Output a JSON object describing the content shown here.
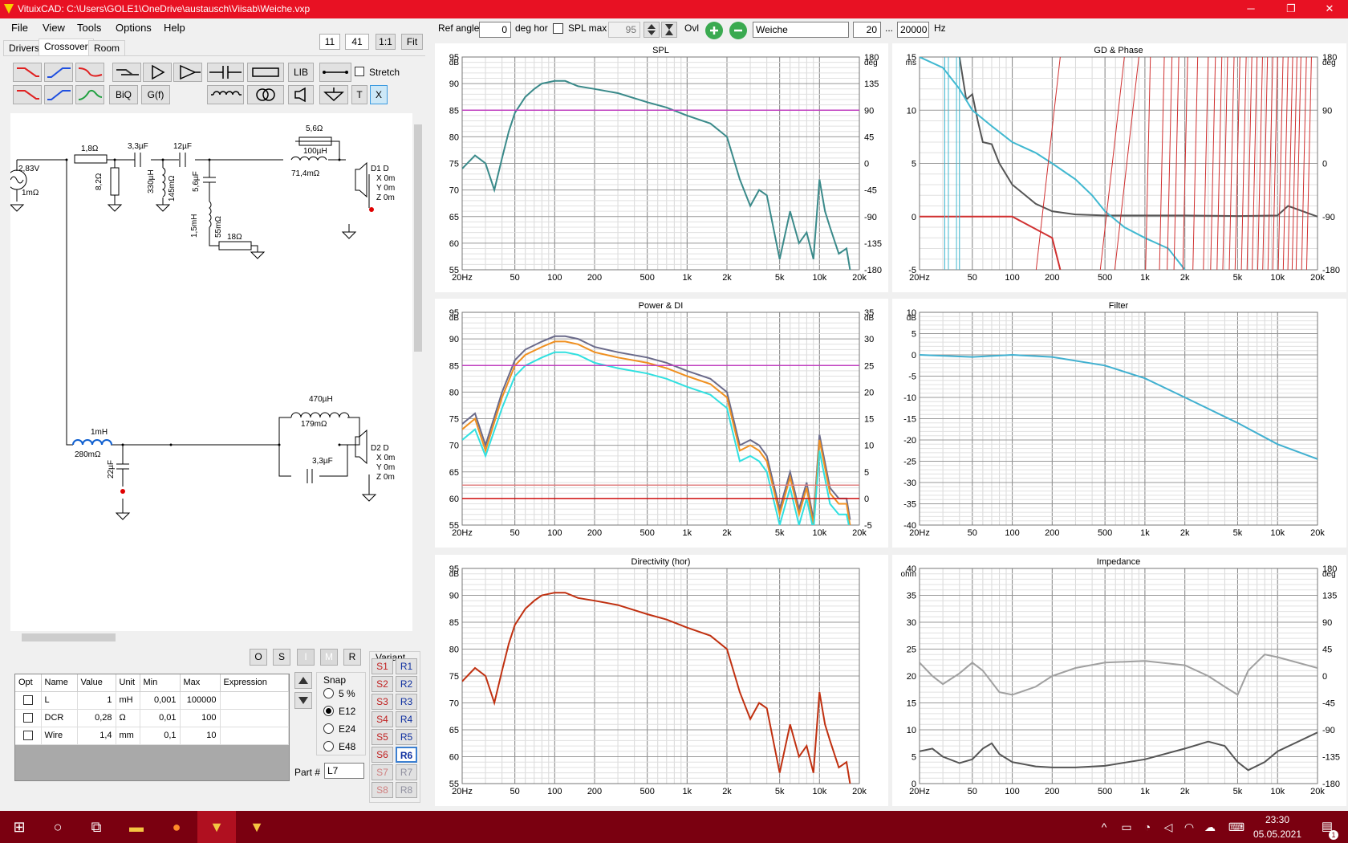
{
  "window": {
    "title": "VituixCAD: C:\\Users\\GOLE1\\OneDrive\\austausch\\Viisab\\Weiche.vxp",
    "min": "─",
    "max": "❐",
    "close": "✕"
  },
  "menu": [
    "File",
    "View",
    "Tools",
    "Options",
    "Help"
  ],
  "zoom": {
    "a": "11",
    "b": "41",
    "one": "1:1",
    "fit": "Fit"
  },
  "tabs": [
    "Drivers",
    "Crossover",
    "Room"
  ],
  "components_row1": [
    "BiQ",
    "G(f)"
  ],
  "lib_label": "LIB",
  "stretch_label": "Stretch",
  "t_label": "T",
  "x_label": "X",
  "schematic": {
    "source_v": "2,83V",
    "source_r": "1mΩ",
    "r1": "1,8Ω",
    "r2": "8,2Ω",
    "c1": "3,3µF",
    "l1": "330µH",
    "l1r": "145mΩ",
    "c2": "12µF",
    "c3": "5,6µF",
    "l2": "1,5mH",
    "l2r": "55mΩ",
    "r3": "18Ω",
    "r4": "5,6Ω",
    "l3": "100µH",
    "l3r": "71,4mΩ",
    "d1": "D1 D",
    "d1x": "X 0m",
    "d1y": "Y 0m",
    "d1z": "Z 0m",
    "l4": "1mH",
    "l4r": "280mΩ",
    "c4": "22µF",
    "l5": "470µH",
    "l5r": "179mΩ",
    "c5": "3,3µF",
    "d2": "D2 D",
    "d2x": "X 0m",
    "d2y": "Y 0m",
    "d2z": "Z 0m"
  },
  "osimr": [
    "O",
    "S",
    "I",
    "M",
    "R"
  ],
  "params": {
    "headers": [
      "Opt",
      "Name",
      "Value",
      "Unit",
      "Min",
      "Max",
      "Expression"
    ],
    "rows": [
      [
        "",
        "L",
        "1",
        "mH",
        "0,001",
        "100000",
        ""
      ],
      [
        "",
        "DCR",
        "0,28",
        "Ω",
        "0,01",
        "100",
        ""
      ],
      [
        "",
        "Wire",
        "1,4",
        "mm",
        "0,1",
        "10",
        ""
      ]
    ]
  },
  "snap": {
    "label": "Snap",
    "options": [
      "5 %",
      "E12",
      "E24",
      "E48"
    ],
    "selected": "E12"
  },
  "part": {
    "label": "Part #",
    "value": "L7"
  },
  "variant": {
    "label": "Variant",
    "s": [
      "S1",
      "S2",
      "S3",
      "S4",
      "S5",
      "S6",
      "S7",
      "S8"
    ],
    "r": [
      "R1",
      "R2",
      "R3",
      "R4",
      "R5",
      "R6",
      "R7",
      "R8"
    ],
    "active": "R6"
  },
  "controls": {
    "ref_angle_label": "Ref angle",
    "ref_angle": "0",
    "deg_hor": "deg hor",
    "spl_max_label": "SPL max",
    "spl_max": "95",
    "ovl": "Ovl",
    "name": "Weiche",
    "f_lo": "20",
    "dots": "...",
    "f_hi": "20000",
    "hz": "Hz"
  },
  "freq_ticks": [
    "20Hz",
    "50",
    "100",
    "200",
    "500",
    "1k",
    "2k",
    "5k",
    "10k",
    "20k"
  ],
  "charts_text": {
    "spl": {
      "title": "SPL",
      "yl_unit": "dB",
      "yr_unit": "deg",
      "yl": [
        "95",
        "90",
        "85",
        "80",
        "75",
        "70",
        "65",
        "60",
        "55"
      ],
      "yr": [
        "180",
        "135",
        "90",
        "45",
        "0",
        "-45",
        "-90",
        "-135",
        "-180"
      ]
    },
    "gd": {
      "title": "GD & Phase",
      "yl_unit": "ms",
      "yr_unit": "deg",
      "yl": [
        "15",
        "10",
        "5",
        "0",
        "-5"
      ],
      "yr": [
        "180",
        "90",
        "0",
        "-90",
        "-180"
      ]
    },
    "pdi": {
      "title": "Power & DI",
      "yl_unit": "dB",
      "yr_unit": "dB",
      "yl": [
        "95",
        "90",
        "85",
        "80",
        "75",
        "70",
        "65",
        "60",
        "55"
      ],
      "yr": [
        "35",
        "30",
        "25",
        "20",
        "15",
        "10",
        "5",
        "0",
        "-5"
      ]
    },
    "filter": {
      "title": "Filter",
      "yl_unit": "dB",
      "yl": [
        "10",
        "5",
        "0",
        "-5",
        "-10",
        "-15",
        "-20",
        "-25",
        "-30",
        "-35",
        "-40"
      ]
    },
    "dir": {
      "title": "Directivity (hor)",
      "yl_unit": "dB",
      "yl": [
        "95",
        "90",
        "85",
        "80",
        "75",
        "70",
        "65",
        "60",
        "55"
      ]
    },
    "imp": {
      "title": "Impedance",
      "yl_unit": "ohm",
      "yr_unit": "deg",
      "yl": [
        "40",
        "35",
        "30",
        "25",
        "20",
        "15",
        "10",
        "5",
        "0"
      ],
      "yr": [
        "180",
        "135",
        "90",
        "45",
        "0",
        "-45",
        "-90",
        "-135",
        "-180"
      ]
    }
  },
  "chart_data": [
    {
      "type": "line",
      "title": "SPL",
      "xlabel": "",
      "ylabel": "dB",
      "xlim": [
        20,
        20000
      ],
      "ylim": [
        55,
        95
      ],
      "xscale": "log",
      "series": [
        {
          "color": "#3a8a8a",
          "x": [
            20,
            25,
            30,
            35,
            40,
            45,
            50,
            60,
            70,
            80,
            100,
            120,
            150,
            200,
            300,
            500,
            700,
            1000,
            1500,
            2000,
            2500,
            3000,
            3500,
            4000,
            5000,
            6000,
            7000,
            8000,
            9000,
            10000,
            11000,
            12000,
            14000,
            16000,
            17000
          ],
          "y": [
            74,
            76.5,
            75,
            70,
            76,
            81,
            84.5,
            87.5,
            89,
            90,
            90.5,
            90.5,
            89.5,
            89,
            88.2,
            86.5,
            85.5,
            84,
            82.5,
            80,
            72,
            67,
            70,
            69,
            57,
            66,
            60,
            62,
            57,
            72,
            66,
            63,
            58,
            59,
            55
          ]
        },
        {
          "color": "#c040c0",
          "x": [
            20,
            20000
          ],
          "y": [
            85,
            85
          ]
        }
      ]
    },
    {
      "type": "line",
      "title": "GD & Phase",
      "ylabel": "ms",
      "xlim": [
        20,
        20000
      ],
      "ylim": [
        -5,
        15
      ],
      "xscale": "log",
      "series": [
        {
          "color": "#555555",
          "x": [
            40,
            45,
            50,
            55,
            60,
            70,
            80,
            100,
            120,
            150,
            200,
            300,
            500,
            1000,
            2000,
            5000,
            10000,
            12000,
            20000
          ],
          "y": [
            15,
            11,
            11.5,
            9,
            7,
            6.8,
            5,
            3,
            2.2,
            1.2,
            0.5,
            0.2,
            0.1,
            0.1,
            0.1,
            0.05,
            0.1,
            1,
            0
          ]
        },
        {
          "color": "#40b8d0",
          "x": [
            20,
            30,
            40,
            50,
            70,
            100,
            150,
            200,
            300,
            400,
            500,
            700,
            1000,
            1500,
            2000
          ],
          "y": [
            15,
            14,
            12,
            10,
            8.5,
            7,
            6,
            5,
            3.5,
            2,
            0.5,
            -1,
            -2,
            -3,
            -5
          ]
        },
        {
          "color": "#d03030",
          "x": [
            20,
            100,
            200,
            230
          ],
          "y": [
            0,
            0,
            -2,
            -5
          ]
        }
      ]
    },
    {
      "type": "line",
      "title": "Power & DI",
      "ylabel": "dB",
      "xlim": [
        20,
        20000
      ],
      "ylim": [
        55,
        95
      ],
      "xscale": "log",
      "series": [
        {
          "color": "#6a6a8a",
          "x": [
            20,
            25,
            30,
            40,
            50,
            60,
            80,
            100,
            120,
            150,
            200,
            300,
            500,
            700,
            1000,
            1500,
            2000,
            2500,
            3000,
            3500,
            4000,
            5000,
            6000,
            7000,
            8000,
            9000,
            10000,
            12000,
            14000,
            16000,
            17000
          ],
          "y": [
            74,
            76,
            70,
            80,
            86,
            88,
            89.5,
            90.5,
            90.5,
            90,
            88.5,
            87.5,
            86.5,
            85.5,
            84,
            82.5,
            80,
            70,
            71,
            70,
            68,
            58,
            65,
            58,
            63,
            56,
            72,
            62,
            60,
            60,
            56
          ]
        },
        {
          "color": "#f09020",
          "x": [
            20,
            25,
            30,
            40,
            50,
            60,
            80,
            100,
            120,
            150,
            200,
            300,
            500,
            700,
            1000,
            1500,
            2000,
            2500,
            3000,
            3500,
            4000,
            5000,
            6000,
            7000,
            8000,
            9000,
            10000,
            12000,
            14000,
            16000,
            17000
          ],
          "y": [
            73,
            75,
            69,
            79,
            85,
            87,
            88.5,
            89.5,
            89.5,
            89,
            87.5,
            86.5,
            85.5,
            84.5,
            83,
            81.5,
            79,
            69,
            70,
            69,
            67,
            57,
            64,
            57,
            62,
            55,
            71,
            61,
            59,
            59,
            55
          ]
        },
        {
          "color": "#30e0e0",
          "x": [
            20,
            25,
            30,
            40,
            50,
            60,
            80,
            100,
            120,
            150,
            200,
            300,
            500,
            700,
            1000,
            1500,
            2000,
            2500,
            3000,
            3500,
            4000,
            5000,
            6000,
            7000,
            8000,
            9000,
            10000,
            12000,
            14000,
            16000,
            17000
          ],
          "y": [
            71,
            73,
            68,
            77,
            83,
            85,
            86.5,
            87.5,
            87.5,
            87,
            85.5,
            84.5,
            83.5,
            82.5,
            81,
            79.5,
            77,
            67,
            68,
            67,
            65,
            55,
            62,
            55,
            60,
            54,
            69,
            59,
            57,
            57,
            54
          ]
        },
        {
          "color": "#c040c0",
          "x": [
            20,
            20000
          ],
          "y": [
            85,
            85
          ]
        },
        {
          "color": "#e08080",
          "x": [
            20,
            20000
          ],
          "y": [
            62.5,
            62.5
          ]
        },
        {
          "color": "#d01010",
          "x": [
            20,
            20000
          ],
          "y": [
            60,
            60
          ]
        }
      ]
    },
    {
      "type": "line",
      "title": "Filter",
      "ylabel": "dB",
      "xlim": [
        20,
        20000
      ],
      "ylim": [
        -40,
        10
      ],
      "xscale": "log",
      "series": [
        {
          "color": "#40b0d0",
          "x": [
            20,
            50,
            100,
            200,
            500,
            1000,
            2000,
            5000,
            10000,
            20000
          ],
          "y": [
            0,
            -0.5,
            0,
            -0.5,
            -2.5,
            -5.5,
            -10,
            -16,
            -21,
            -24.5
          ]
        }
      ]
    },
    {
      "type": "line",
      "title": "Directivity (hor)",
      "ylabel": "dB",
      "xlim": [
        20,
        20000
      ],
      "ylim": [
        55,
        95
      ],
      "xscale": "log",
      "series": [
        {
          "color": "#c03010",
          "x": [
            20,
            25,
            30,
            35,
            40,
            45,
            50,
            60,
            70,
            80,
            100,
            120,
            150,
            200,
            300,
            500,
            700,
            1000,
            1500,
            2000,
            2500,
            3000,
            3500,
            4000,
            5000,
            6000,
            7000,
            8000,
            9000,
            10000,
            11000,
            12000,
            14000,
            16000,
            17000
          ],
          "y": [
            74,
            76.5,
            75,
            70,
            76,
            81,
            84.5,
            87.5,
            89,
            90,
            90.5,
            90.5,
            89.5,
            89,
            88.2,
            86.5,
            85.5,
            84,
            82.5,
            80,
            72,
            67,
            70,
            69,
            57,
            66,
            60,
            62,
            57,
            72,
            66,
            63,
            58,
            59,
            55
          ]
        }
      ]
    },
    {
      "type": "line",
      "title": "Impedance",
      "ylabel": "ohm",
      "xlim": [
        20,
        20000
      ],
      "ylim": [
        0,
        40
      ],
      "xscale": "log",
      "series": [
        {
          "color": "#555555",
          "x": [
            20,
            25,
            30,
            40,
            50,
            60,
            70,
            80,
            100,
            150,
            200,
            300,
            500,
            1000,
            2000,
            3000,
            4000,
            5000,
            6000,
            8000,
            10000,
            20000
          ],
          "y": [
            6,
            6.5,
            5,
            3.8,
            4.5,
            6.5,
            7.5,
            5.5,
            4,
            3.2,
            3,
            3,
            3.3,
            4.5,
            6.5,
            7.8,
            7,
            4,
            2.5,
            4,
            6,
            9.5
          ]
        },
        {
          "color": "#a0a0a0",
          "x": [
            20,
            25,
            30,
            40,
            50,
            60,
            80,
            100,
            150,
            200,
            300,
            500,
            1000,
            2000,
            3000,
            4000,
            5000,
            6000,
            8000,
            10000,
            20000
          ],
          "y": [
            22.5,
            20,
            18.5,
            20.5,
            22.5,
            21,
            17,
            16.5,
            18,
            20,
            21.5,
            22.5,
            22.8,
            22,
            20,
            18,
            16.5,
            21,
            24,
            23.5,
            21.5
          ]
        }
      ]
    }
  ],
  "taskbar": {
    "time": "23:30",
    "date": "05.05.2021",
    "notif": "1"
  }
}
